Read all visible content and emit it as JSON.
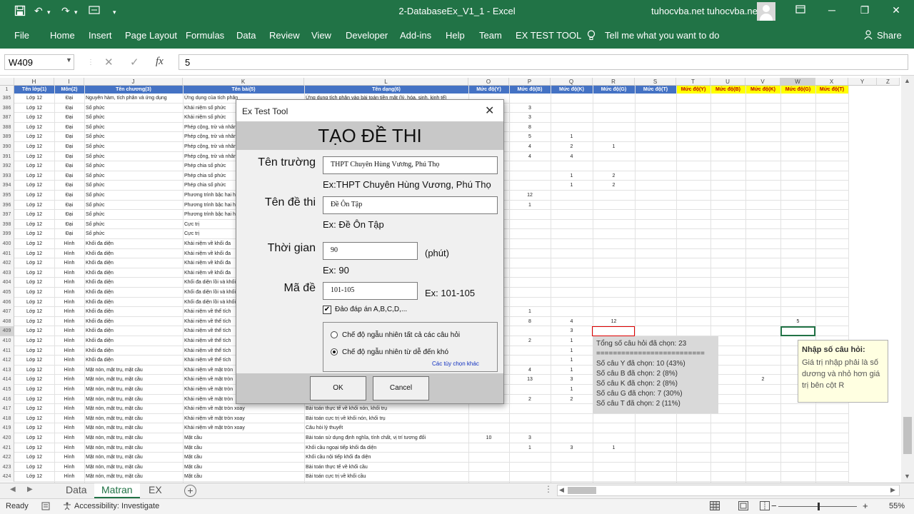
{
  "titlebar": {
    "title": "2-DatabaseEx_V1_1  -  Excel",
    "account": "tuhocvba.net tuhocvba.net",
    "icons": [
      "save-icon",
      "undo-icon",
      "redo-icon",
      "customize-qat-icon",
      "account-avatar-icon",
      "ribbon-display-icon",
      "minimize-icon",
      "restore-icon",
      "close-icon"
    ]
  },
  "ribbon": {
    "tabs": [
      "File",
      "Home",
      "Insert",
      "Page Layout",
      "Formulas",
      "Data",
      "Review",
      "View",
      "Developer",
      "Add-ins",
      "Help",
      "Team",
      "EX TEST TOOL"
    ],
    "tell_me": "Tell me what you want to do",
    "share": "Share"
  },
  "formula_bar": {
    "name_box": "W409",
    "fx": "fx",
    "value": "5"
  },
  "sheet": {
    "columns": [
      "H",
      "I",
      "J",
      "K",
      "L",
      "O",
      "P",
      "Q",
      "R",
      "S",
      "T",
      "U",
      "V",
      "W",
      "X",
      "Y",
      "Z"
    ],
    "selected_column": "W",
    "header_row_number": "1",
    "headers_blue": [
      "Tên lớp(1)",
      "Môn(2)",
      "Tên chương(3)",
      "Tên bài(5)",
      "Tên dạng(6)",
      "Mức độ(Y)",
      "Mức độ(B)",
      "Mức độ(K)",
      "Mức độ(G)",
      "Mức độ(T)"
    ],
    "headers_yellow": [
      "Mức độ(Y)",
      "Mức độ(B)",
      "Mức độ(K)",
      "Mức độ(G)",
      "Mức độ(T)"
    ],
    "selected_row": "409",
    "rows": [
      {
        "n": "385",
        "lop": "Lớp 12",
        "mon": "Đại",
        "chuong": "Nguyên hàm, tích phân và ứng dụng",
        "bai": "Ứng dụng của tích phân",
        "dang": "Ứng dụng tích phân vào bài toán tiền mặt (lý, hóa, sinh, kinh tế)",
        "vals": [
          "",
          "",
          "",
          "",
          "",
          "",
          "",
          "",
          "",
          ""
        ]
      },
      {
        "n": "386",
        "lop": "Lớp 12",
        "mon": "Đại",
        "chuong": "Số phức",
        "bai": "Khái niệm số phức",
        "dang": "",
        "vals": [
          "",
          "3",
          "",
          "",
          "",
          "",
          "",
          "",
          "",
          ""
        ]
      },
      {
        "n": "387",
        "lop": "Lớp 12",
        "mon": "Đại",
        "chuong": "Số phức",
        "bai": "Khái niệm số phức",
        "dang": "",
        "vals": [
          "",
          "3",
          "",
          "",
          "",
          "",
          "",
          "",
          "",
          ""
        ]
      },
      {
        "n": "388",
        "lop": "Lớp 12",
        "mon": "Đại",
        "chuong": "Số phức",
        "bai": "Phép cộng, trừ và nhân",
        "dang": "",
        "vals": [
          "",
          "8",
          "",
          "",
          "",
          "",
          "",
          "",
          "",
          ""
        ]
      },
      {
        "n": "389",
        "lop": "Lớp 12",
        "mon": "Đại",
        "chuong": "Số phức",
        "bai": "Phép cộng, trừ và nhân",
        "dang": "",
        "vals": [
          "",
          "5",
          "1",
          "",
          "",
          "",
          "",
          "",
          "",
          ""
        ]
      },
      {
        "n": "390",
        "lop": "Lớp 12",
        "mon": "Đại",
        "chuong": "Số phức",
        "bai": "Phép cộng, trừ và nhân",
        "dang": "",
        "vals": [
          "",
          "4",
          "2",
          "1",
          "",
          "",
          "",
          "",
          "",
          ""
        ]
      },
      {
        "n": "391",
        "lop": "Lớp 12",
        "mon": "Đại",
        "chuong": "Số phức",
        "bai": "Phép cộng, trừ và nhân",
        "dang": "",
        "vals": [
          "",
          "4",
          "4",
          "",
          "",
          "",
          "",
          "",
          "",
          ""
        ]
      },
      {
        "n": "392",
        "lop": "Lớp 12",
        "mon": "Đại",
        "chuong": "Số phức",
        "bai": "Phép chia số phức",
        "dang": "",
        "vals": [
          "",
          "",
          "",
          "",
          "",
          "",
          "",
          "",
          "",
          ""
        ]
      },
      {
        "n": "393",
        "lop": "Lớp 12",
        "mon": "Đại",
        "chuong": "Số phức",
        "bai": "Phép chia số phức",
        "dang": "",
        "vals": [
          "",
          "",
          "1",
          "2",
          "",
          "",
          "",
          "",
          "",
          ""
        ]
      },
      {
        "n": "394",
        "lop": "Lớp 12",
        "mon": "Đại",
        "chuong": "Số phức",
        "bai": "Phép chia số phức",
        "dang": "",
        "vals": [
          "",
          "",
          "1",
          "2",
          "",
          "",
          "",
          "",
          "",
          ""
        ]
      },
      {
        "n": "395",
        "lop": "Lớp 12",
        "mon": "Đại",
        "chuong": "Số phức",
        "bai": "Phương trình bậc hai hệ",
        "dang": "",
        "vals": [
          "",
          "12",
          "",
          "",
          "",
          "",
          "",
          "",
          "",
          ""
        ]
      },
      {
        "n": "396",
        "lop": "Lớp 12",
        "mon": "Đại",
        "chuong": "Số phức",
        "bai": "Phương trình bậc hai hệ",
        "dang": "",
        "vals": [
          "",
          "1",
          "",
          "",
          "",
          "",
          "",
          "",
          "",
          ""
        ]
      },
      {
        "n": "397",
        "lop": "Lớp 12",
        "mon": "Đại",
        "chuong": "Số phức",
        "bai": "Phương trình bậc hai hệ",
        "dang": "",
        "vals": [
          "",
          "",
          "",
          "",
          "",
          "",
          "",
          "",
          "",
          ""
        ]
      },
      {
        "n": "398",
        "lop": "Lớp 12",
        "mon": "Đại",
        "chuong": "Số phức",
        "bai": "Cực trị",
        "dang": "",
        "vals": [
          "",
          "",
          "",
          "",
          "",
          "",
          "",
          "",
          "",
          ""
        ]
      },
      {
        "n": "399",
        "lop": "Lớp 12",
        "mon": "Đại",
        "chuong": "Số phức",
        "bai": "Cực trị",
        "dang": "",
        "vals": [
          "",
          "",
          "",
          "",
          "",
          "",
          "",
          "",
          "",
          ""
        ]
      },
      {
        "n": "400",
        "lop": "Lớp 12",
        "mon": "Hình",
        "chuong": "Khối đa diện",
        "bai": "Khái niệm về khối đa",
        "dang": "",
        "vals": [
          "",
          "",
          "",
          "",
          "",
          "",
          "",
          "",
          "",
          ""
        ]
      },
      {
        "n": "401",
        "lop": "Lớp 12",
        "mon": "Hình",
        "chuong": "Khối đa diện",
        "bai": "Khái niệm về khối đa",
        "dang": "",
        "vals": [
          "",
          "",
          "",
          "",
          "",
          "",
          "",
          "",
          "",
          ""
        ]
      },
      {
        "n": "402",
        "lop": "Lớp 12",
        "mon": "Hình",
        "chuong": "Khối đa diện",
        "bai": "Khái niệm về khối đa",
        "dang": "",
        "vals": [
          "",
          "",
          "",
          "",
          "",
          "",
          "",
          "",
          "",
          ""
        ]
      },
      {
        "n": "403",
        "lop": "Lớp 12",
        "mon": "Hình",
        "chuong": "Khối đa diện",
        "bai": "Khái niệm về khối đa",
        "dang": "",
        "vals": [
          "",
          "",
          "",
          "",
          "",
          "",
          "",
          "",
          "",
          ""
        ]
      },
      {
        "n": "404",
        "lop": "Lớp 12",
        "mon": "Hình",
        "chuong": "Khối đa diện",
        "bai": "Khối đa diện lồi và khối",
        "dang": "",
        "vals": [
          "",
          "",
          "",
          "",
          "",
          "",
          "",
          "",
          "",
          ""
        ]
      },
      {
        "n": "405",
        "lop": "Lớp 12",
        "mon": "Hình",
        "chuong": "Khối đa diện",
        "bai": "Khối đa diện lồi và khối",
        "dang": "",
        "vals": [
          "",
          "",
          "",
          "",
          "",
          "",
          "",
          "",
          "",
          ""
        ]
      },
      {
        "n": "406",
        "lop": "Lớp 12",
        "mon": "Hình",
        "chuong": "Khối đa diện",
        "bai": "Khối đa diện lồi và khối",
        "dang": "",
        "vals": [
          "",
          "",
          "",
          "",
          "",
          "",
          "",
          "",
          "",
          ""
        ]
      },
      {
        "n": "407",
        "lop": "Lớp 12",
        "mon": "Hình",
        "chuong": "Khối đa diện",
        "bai": "Khái niệm về thể tích",
        "dang": "",
        "vals": [
          "",
          "1",
          "",
          "",
          "",
          "",
          "",
          "",
          "",
          ""
        ]
      },
      {
        "n": "408",
        "lop": "Lớp 12",
        "mon": "Hình",
        "chuong": "Khối đa diện",
        "bai": "Khái niệm về thể tích",
        "dang": "",
        "vals": [
          "",
          "8",
          "4",
          "12",
          "",
          "",
          "",
          "",
          "5",
          ""
        ]
      },
      {
        "n": "409",
        "lop": "Lớp 12",
        "mon": "Hình",
        "chuong": "Khối đa diện",
        "bai": "Khái niệm về thể tích",
        "dang": "",
        "vals": [
          "",
          "",
          "3",
          "",
          "",
          "",
          "",
          "",
          "",
          ""
        ]
      },
      {
        "n": "410",
        "lop": "Lớp 12",
        "mon": "Hình",
        "chuong": "Khối đa diện",
        "bai": "Khái niệm về thể tích",
        "dang": "",
        "vals": [
          "",
          "2",
          "1",
          "",
          "",
          "",
          "",
          "",
          "",
          ""
        ]
      },
      {
        "n": "411",
        "lop": "Lớp 12",
        "mon": "Hình",
        "chuong": "Khối đa diện",
        "bai": "Khái niệm về thể tích",
        "dang": "",
        "vals": [
          "",
          "",
          "1",
          "",
          "",
          "",
          "",
          "",
          "",
          ""
        ]
      },
      {
        "n": "412",
        "lop": "Lớp 12",
        "mon": "Hình",
        "chuong": "Khối đa diện",
        "bai": "Khái niệm về thể tích",
        "dang": "",
        "vals": [
          "",
          "",
          "1",
          "",
          "",
          "",
          "",
          "",
          "",
          ""
        ]
      },
      {
        "n": "413",
        "lop": "Lớp 12",
        "mon": "Hình",
        "chuong": "Mặt nón, mặt trụ, mặt cầu",
        "bai": "Khái niệm về mặt tròn",
        "dang": "",
        "vals": [
          "",
          "4",
          "1",
          "",
          "",
          "",
          "",
          "",
          "",
          ""
        ]
      },
      {
        "n": "414",
        "lop": "Lớp 12",
        "mon": "Hình",
        "chuong": "Mặt nón, mặt trụ, mặt cầu",
        "bai": "Khái niệm về mặt tròn",
        "dang": "",
        "vals": [
          "",
          "13",
          "3",
          "",
          "",
          "",
          "",
          "2",
          "",
          ""
        ]
      },
      {
        "n": "415",
        "lop": "Lớp 12",
        "mon": "Hình",
        "chuong": "Mặt nón, mặt trụ, mặt cầu",
        "bai": "Khái niệm về mặt tròn",
        "dang": "",
        "vals": [
          "",
          "",
          "1",
          "",
          "",
          "",
          "",
          "",
          "",
          ""
        ]
      },
      {
        "n": "416",
        "lop": "Lớp 12",
        "mon": "Hình",
        "chuong": "Mặt nón, mặt trụ, mặt cầu",
        "bai": "Khái niệm về mặt tròn",
        "dang": "",
        "vals": [
          "",
          "2",
          "2",
          "",
          "",
          "",
          "",
          "",
          "",
          "1"
        ]
      },
      {
        "n": "417",
        "lop": "Lớp 12",
        "mon": "Hình",
        "chuong": "Mặt nón, mặt trụ, mặt cầu",
        "bai": "Khái niệm về mặt tròn xoay",
        "dang": "Bài toán thực tế về khối nón, khối trụ",
        "vals": [
          "",
          "",
          "",
          "",
          "",
          "",
          "",
          "",
          "",
          ""
        ]
      },
      {
        "n": "418",
        "lop": "Lớp 12",
        "mon": "Hình",
        "chuong": "Mặt nón, mặt trụ, mặt cầu",
        "bai": "Khái niệm về mặt tròn xoay",
        "dang": "Bài toán cực trị về khối nón, khối trụ",
        "vals": [
          "",
          "",
          "",
          "",
          "",
          "",
          "",
          "",
          "",
          ""
        ]
      },
      {
        "n": "419",
        "lop": "Lớp 12",
        "mon": "Hình",
        "chuong": "Mặt nón, mặt trụ, mặt cầu",
        "bai": "Khái niệm về mặt tròn xoay",
        "dang": "Câu hỏi lý thuyết",
        "vals": [
          "",
          "",
          "",
          "",
          "",
          "",
          "",
          "",
          "",
          ""
        ]
      },
      {
        "n": "420",
        "lop": "Lớp 12",
        "mon": "Hình",
        "chuong": "Mặt nón, mặt trụ, mặt cầu",
        "bai": "Mặt cầu",
        "dang": "Bài toán sử dụng định nghĩa, tính chất, vị trí tương đối",
        "vals": [
          "10",
          "3",
          "",
          "",
          "",
          "",
          "",
          "",
          "",
          ""
        ]
      },
      {
        "n": "421",
        "lop": "Lớp 12",
        "mon": "Hình",
        "chuong": "Mặt nón, mặt trụ, mặt cầu",
        "bai": "Mặt cầu",
        "dang": "Khối cầu ngoại tiếp khối đa diện",
        "vals": [
          "",
          "1",
          "3",
          "1",
          "",
          "",
          "",
          "",
          "",
          ""
        ]
      },
      {
        "n": "422",
        "lop": "Lớp 12",
        "mon": "Hình",
        "chuong": "Mặt nón, mặt trụ, mặt cầu",
        "bai": "Mặt cầu",
        "dang": "Khối cầu nội tiếp khối đa diện",
        "vals": [
          "",
          "",
          "",
          "",
          "",
          "",
          "",
          "",
          "",
          ""
        ]
      },
      {
        "n": "423",
        "lop": "Lớp 12",
        "mon": "Hình",
        "chuong": "Mặt nón, mặt trụ, mặt cầu",
        "bai": "Mặt cầu",
        "dang": "Bài toán thực tế về khối cầu",
        "vals": [
          "",
          "",
          "",
          "",
          "",
          "",
          "",
          "",
          "",
          ""
        ]
      },
      {
        "n": "424",
        "lop": "Lớp 12",
        "mon": "Hình",
        "chuong": "Mặt nón, mặt trụ, mặt cầu",
        "bai": "Mặt cầu",
        "dang": "Bài toán cực trị về khối cầu",
        "vals": [
          "",
          "",
          "",
          "",
          "",
          "",
          "",
          "",
          "",
          ""
        ]
      }
    ]
  },
  "summary": {
    "total": "Tổng số câu hỏi đã chọn: 23",
    "divider": "==========================",
    "lines": [
      "Số câu Y đã chọn: 10 (43%)",
      "Số câu B đã chọn: 2 (8%)",
      "Số câu K đã chọn: 2 (8%)",
      "Số câu G đã chọn: 7 (30%)",
      "Số câu T đã chọn: 2 (11%)"
    ]
  },
  "tooltip": {
    "title": "Nhập số câu hỏi:",
    "body": "Giá trị nhập phải là số dương và nhỏ hơn giá trị bên cột R"
  },
  "dialog": {
    "title": "Ex Test Tool",
    "banner": "TẠO ĐỀ THI",
    "school_label": "Tên trường",
    "school_value": "THPT Chuyên Hùng Vương, Phú Thọ",
    "school_hint": "Ex:THPT Chuyên Hùng Vương, Phú Thọ",
    "exam_label": "Tên đề thi",
    "exam_value": "Đề Ôn Tập",
    "exam_hint": "Ex: Đề Ôn Tập",
    "time_label": "Thời gian",
    "time_value": "90",
    "time_unit": "(phút)",
    "time_hint": "Ex: 90",
    "code_label": "Mã đề",
    "code_value": "101-105",
    "code_hint": "Ex: 101-105",
    "shuffle_label": "Đảo đáp án A,B,C,D,...",
    "shuffle_checked": true,
    "mode_all": "Chế độ ngẫu nhiên tất cả các câu hỏi",
    "mode_easy_hard": "Chế độ ngẫu nhiên từ dễ đến khó",
    "mode_selected": "easy_hard",
    "other_options": "Các tùy chọn khác",
    "ok": "OK",
    "cancel": "Cancel"
  },
  "sheet_tabs": {
    "tabs": [
      "Data",
      "Matran",
      "EX"
    ],
    "active": "Matran"
  },
  "status_bar": {
    "ready": "Ready",
    "accessibility": "Accessibility: Investigate",
    "zoom": "55%"
  },
  "colors": {
    "excel_green": "#217346",
    "header_blue": "#4472c4",
    "header_yellow": "#ffff00",
    "header_yellow_text": "#c00000",
    "tooltip_bg": "#ffffe1"
  }
}
